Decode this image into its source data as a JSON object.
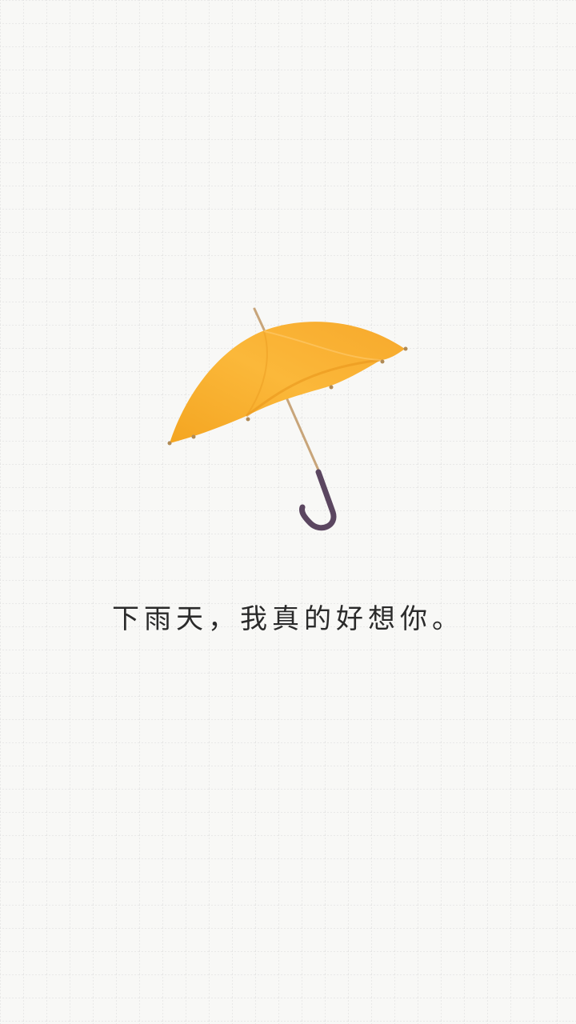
{
  "wallpaper": {
    "caption": "下雨天，我真的好想你。",
    "background_color": "#f8f8f6",
    "grid_color": "#dcdcdc",
    "umbrella_canopy_color": "#f6a928",
    "umbrella_handle_color": "#5b4660",
    "umbrella_shaft_color": "#c8a57a"
  }
}
